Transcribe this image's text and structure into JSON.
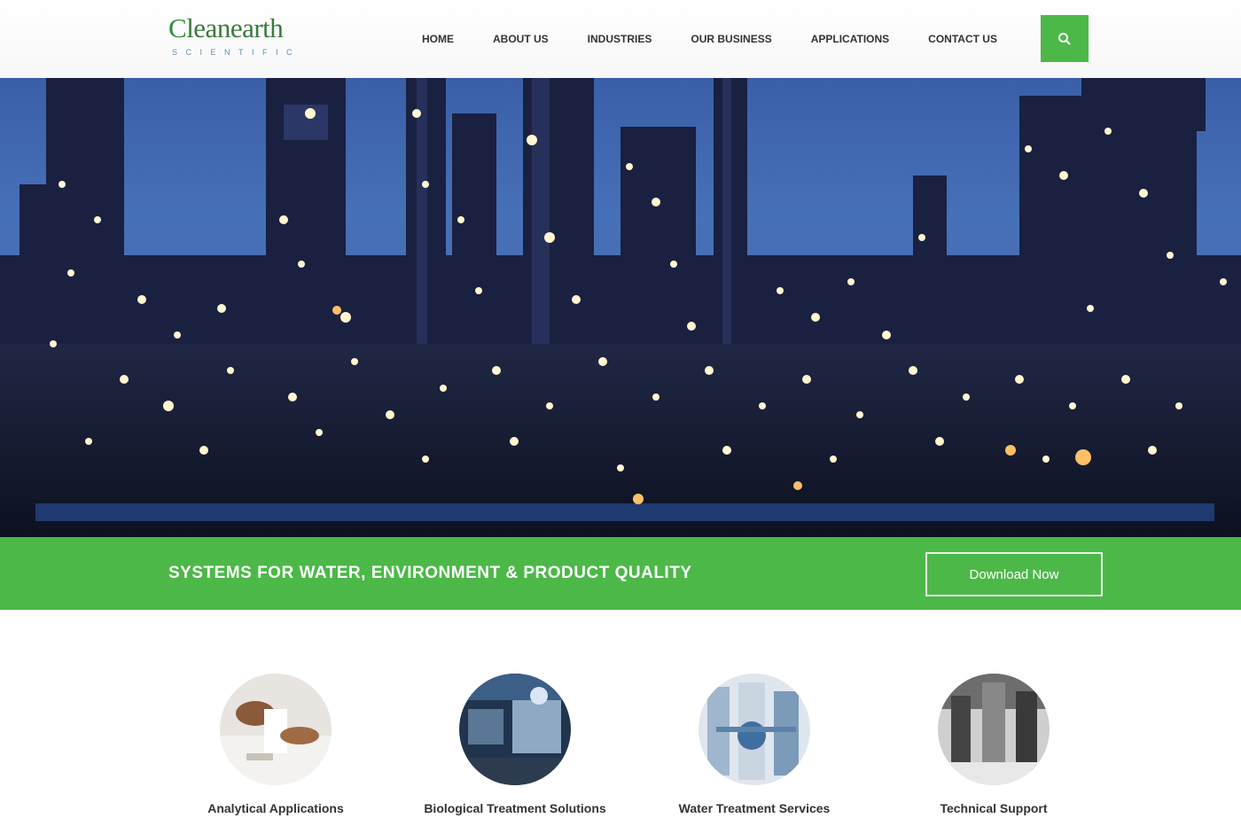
{
  "brand": {
    "logo_first_letter": "C",
    "logo_rest": "leanearth",
    "logo_sub": "SCIENTIFIC",
    "accent_color": "#4cb848",
    "logo_color": "#3a7a3a"
  },
  "nav": {
    "items": [
      {
        "label": "HOME"
      },
      {
        "label": "ABOUT US"
      },
      {
        "label": "INDUSTRIES"
      },
      {
        "label": "OUR BUSINESS"
      },
      {
        "label": "APPLICATIONS"
      },
      {
        "label": "CONTACT US"
      }
    ],
    "search_icon": "search-icon"
  },
  "hero": {
    "image": "night industrial refinery with illuminated towers"
  },
  "banner": {
    "headline": "SYSTEMS FOR WATER, ENVIRONMENT & PRODUCT QUALITY",
    "button_label": "Download Now"
  },
  "services": {
    "items": [
      {
        "label": "Analytical Applications"
      },
      {
        "label": "Biological Treatment Solutions"
      },
      {
        "label": "Water Treatment Services"
      },
      {
        "label": "Technical Support"
      }
    ]
  }
}
